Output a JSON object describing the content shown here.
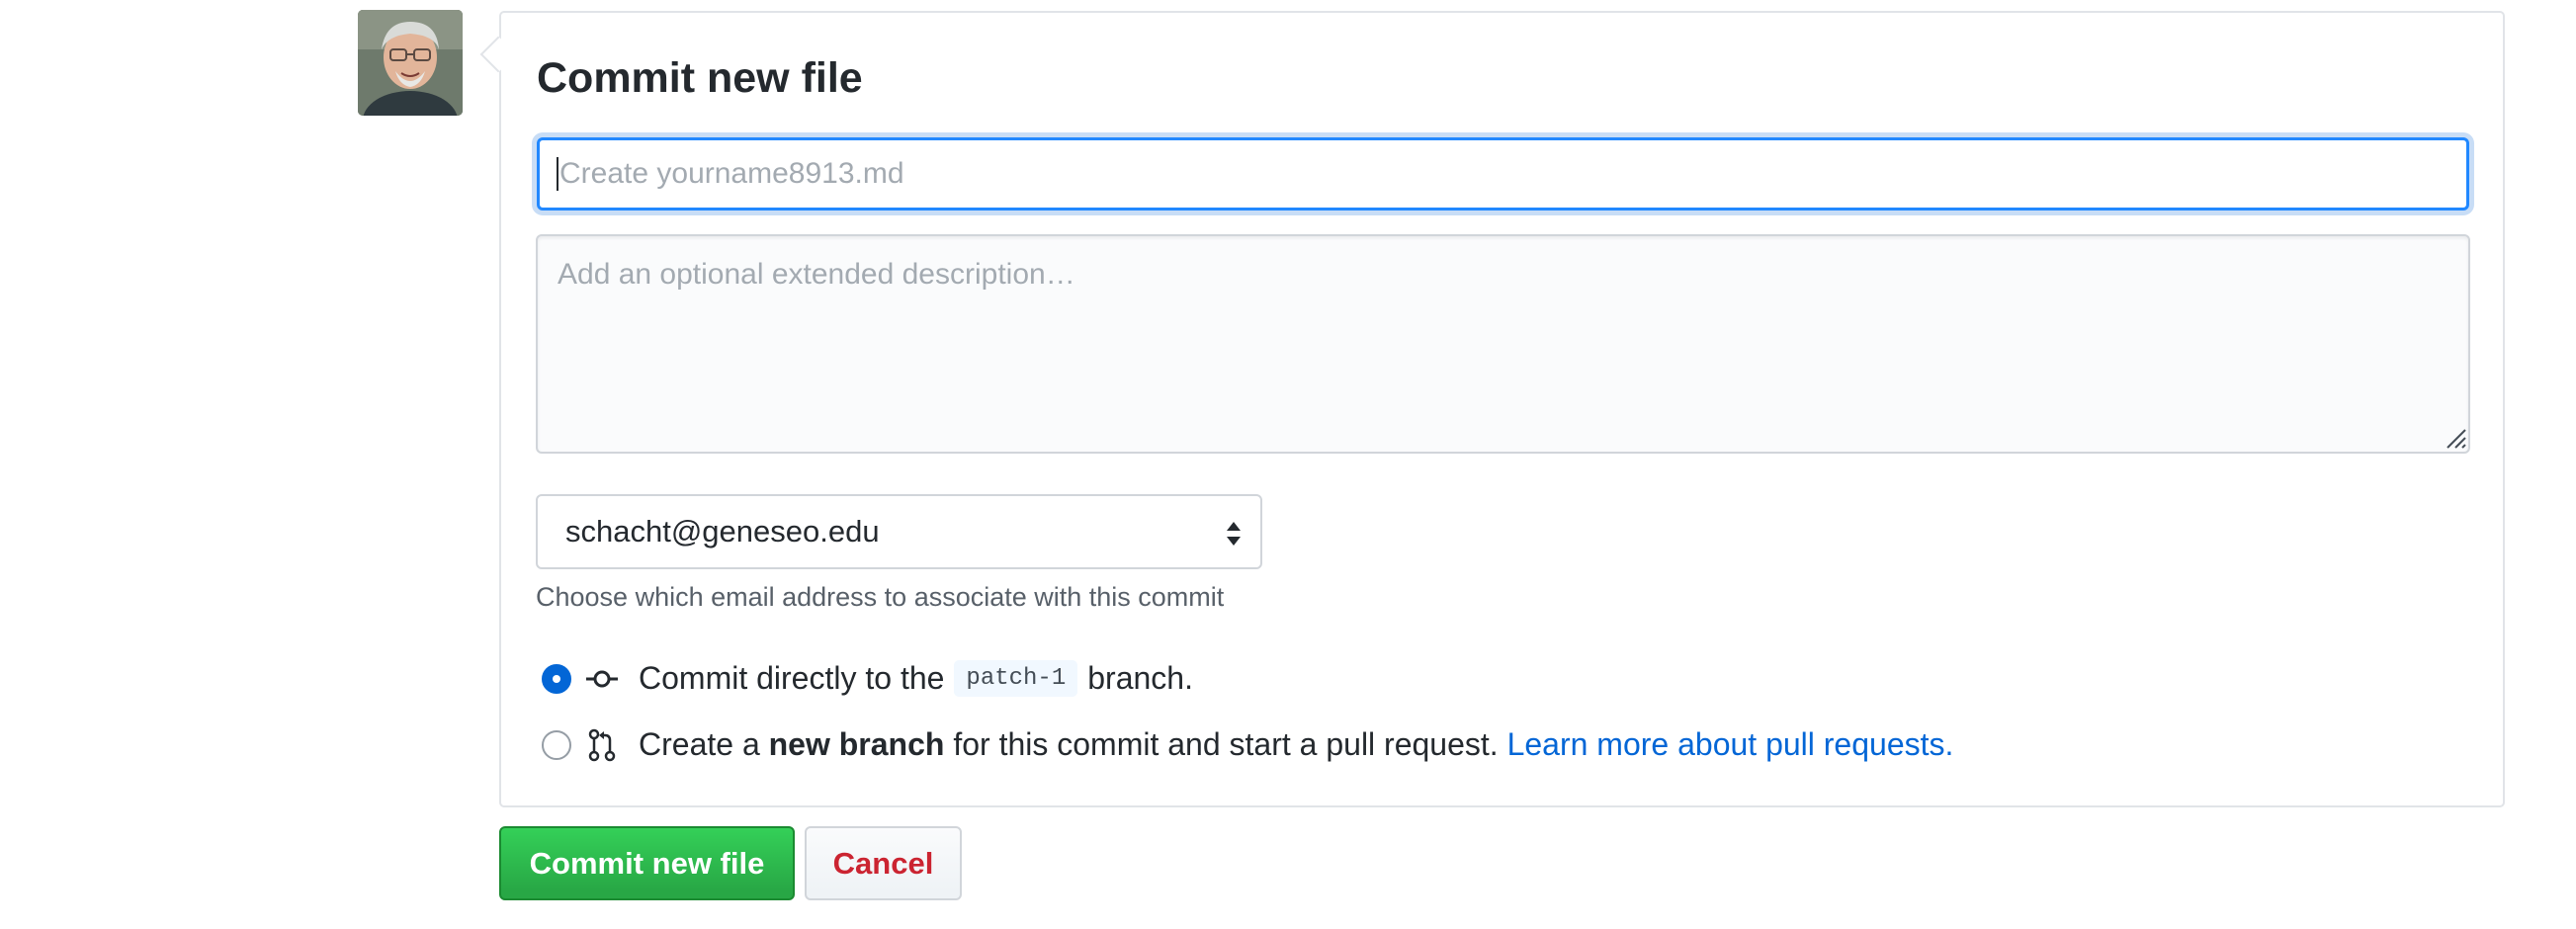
{
  "commit_form": {
    "title": "Commit new file",
    "summary": {
      "value": "",
      "placeholder": "Create yourname8913.md"
    },
    "description": {
      "value": "",
      "placeholder": "Add an optional extended description…"
    },
    "email": {
      "selected": "schacht@geneseo.edu",
      "note": "Choose which email address to associate with this commit"
    },
    "options": {
      "direct": {
        "checked": true,
        "icon": "git-commit-icon",
        "prefix": "Commit directly to the",
        "branch": "patch-1",
        "suffix": "branch."
      },
      "new_branch": {
        "checked": false,
        "icon": "git-pull-request-icon",
        "prefix": "Create a",
        "bold": "new branch",
        "middle": "for this commit and start a pull request.",
        "link": "Learn more about pull requests."
      }
    },
    "buttons": {
      "commit": "Commit new file",
      "cancel": "Cancel"
    }
  },
  "colors": {
    "accent": "#0366d6",
    "focus_border": "#2188ff",
    "commit_green": "#28a745",
    "cancel_red": "#cb2431",
    "muted_text": "#586069",
    "border": "#e1e4e8"
  }
}
